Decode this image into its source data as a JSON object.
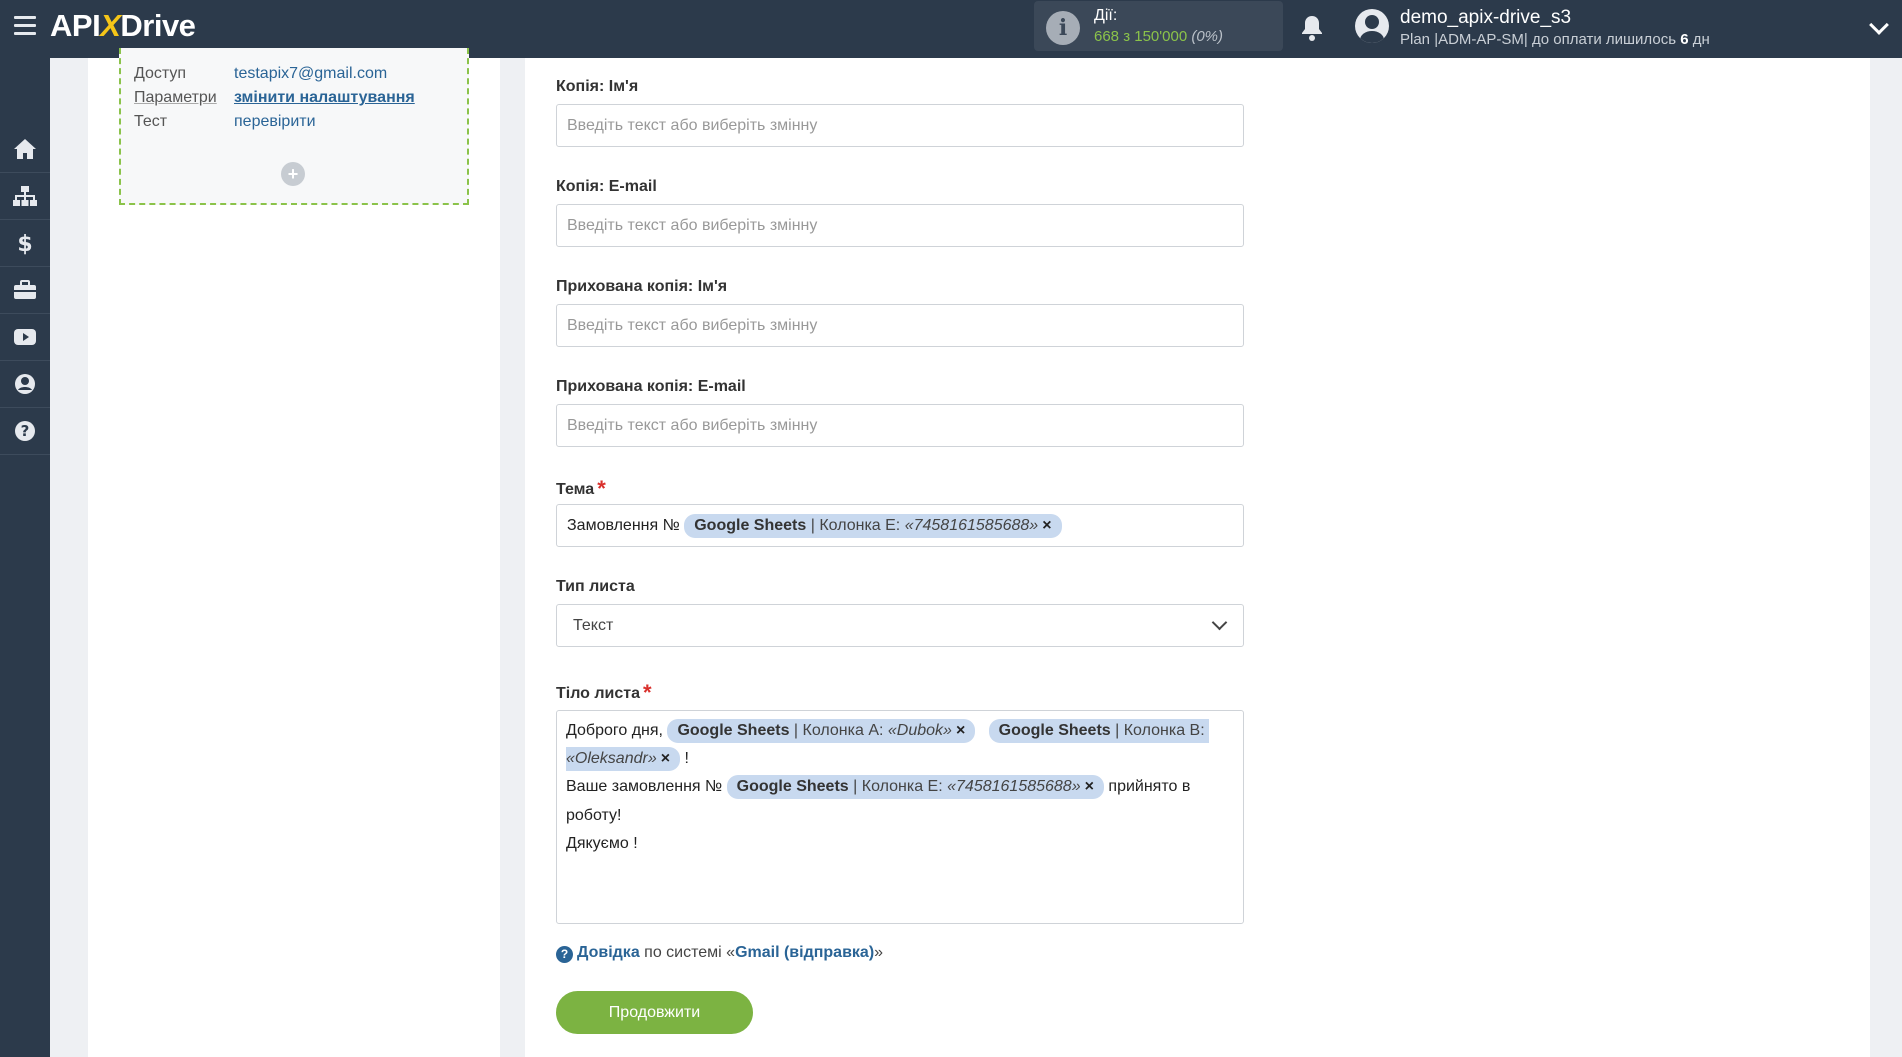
{
  "header": {
    "logo_main": "API",
    "logo_x": "X",
    "logo_tail": "Drive",
    "actions_label": "Дії:",
    "actions_count": "668 з 150'000",
    "actions_percent": "(0%)",
    "username": "demo_apix-drive_s3",
    "plan_prefix": "Plan |ADM-AP-SM| до оплати лишилось",
    "plan_days": "6",
    "plan_suffix": "дн"
  },
  "sidebar": {
    "items": [
      "home-icon",
      "sitemap-icon",
      "dollar-icon",
      "briefcase-icon",
      "youtube-icon",
      "user-icon",
      "help-icon"
    ]
  },
  "destination": {
    "rows": [
      {
        "key": "Доступ",
        "value": "testapix7@gmail.com"
      },
      {
        "key": "Параметри",
        "value": "змінити налаштування"
      },
      {
        "key": "Тест",
        "value": "перевірити"
      }
    ],
    "add_label": "+"
  },
  "form": {
    "placeholder": "Введіть текст або виберіть змінну",
    "cc_name_label": "Копія: Ім'я",
    "cc_email_label": "Копія: E-mail",
    "bcc_name_label": "Прихована копія: Ім'я",
    "bcc_email_label": "Прихована копія: E-mail",
    "subject_label": "Тема",
    "required_mark": "*",
    "subject_text": "Замовлення №",
    "subject_chip": {
      "source": "Google Sheets",
      "detail": "| Колонка E:",
      "value": "«7458161585688»"
    },
    "chip_close": "×",
    "type_label": "Тип листа",
    "type_value": "Текст",
    "body_label": "Тіло листа",
    "body": {
      "line1_text": "Доброго дня,",
      "chip_a": {
        "source": "Google Sheets",
        "detail": "| Колонка A:",
        "value": "«Dubok»"
      },
      "chip_b": {
        "source": "Google Sheets",
        "detail": "| Колонка B:",
        "value": "«Oleksandr»"
      },
      "line2_tail": "!",
      "line3_text": "Ваше замовлення №",
      "chip_e": {
        "source": "Google Sheets",
        "detail": "| Колонка E:",
        "value": "«7458161585688»"
      },
      "line3_tail": "прийнято в",
      "line4_text": "роботу!",
      "line5_text": "Дякуємо !"
    }
  },
  "help": {
    "bold": "Довідка",
    "text": "по системі «",
    "system": "Gmail (відправка)",
    "close": "»"
  },
  "continue_label": "Продовжити"
}
